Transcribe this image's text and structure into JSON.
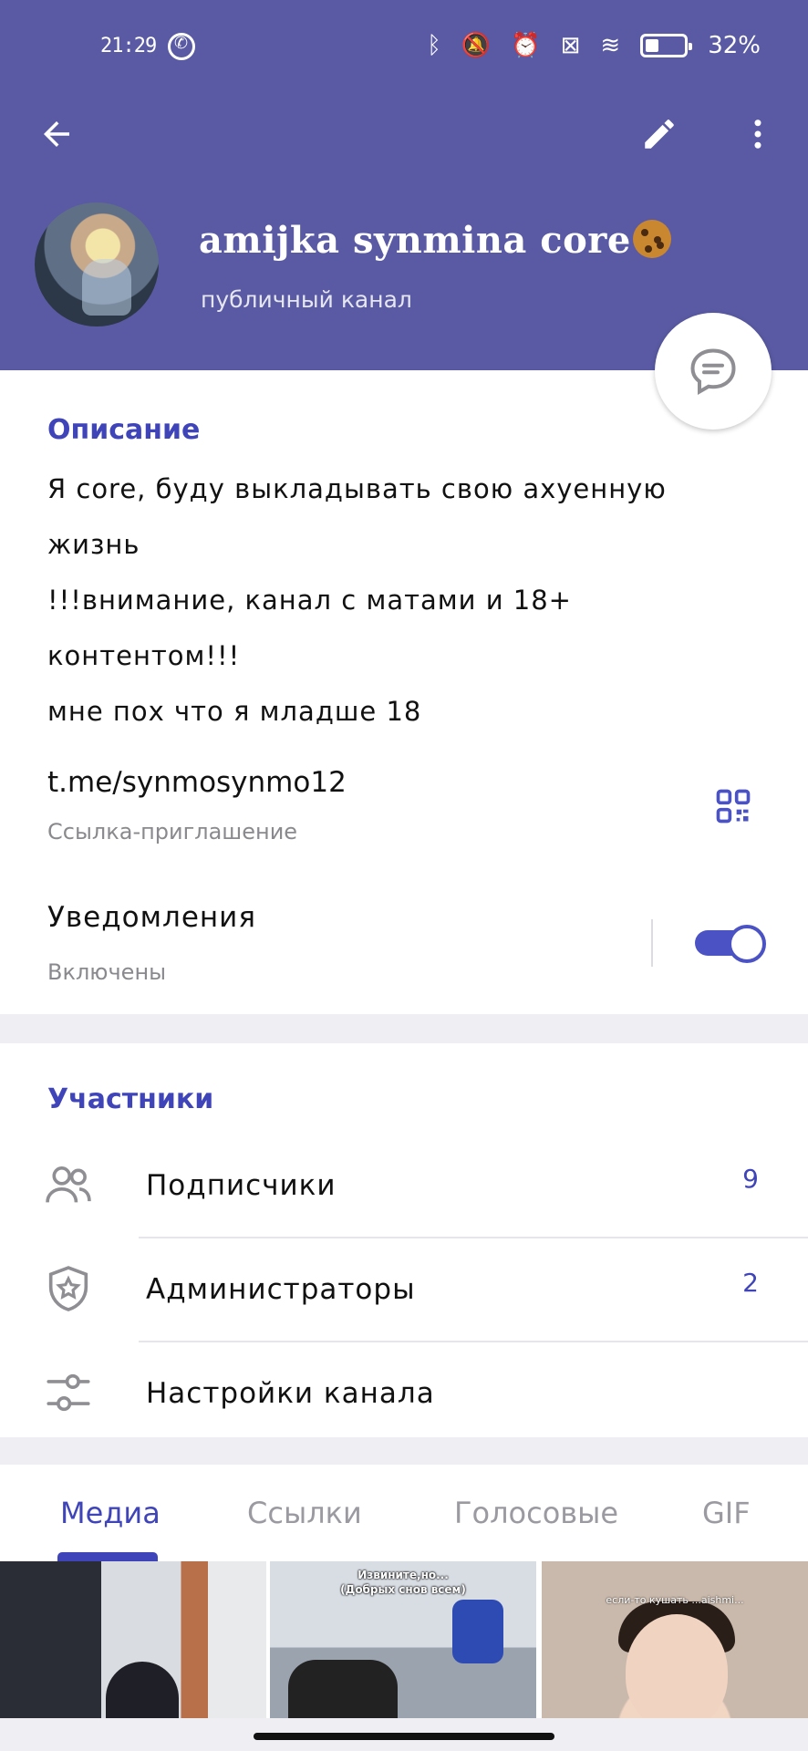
{
  "status_bar": {
    "time": "21:29",
    "battery": "32%",
    "icons": [
      "whatsapp-icon",
      "bluetooth-icon",
      "mute-icon",
      "alarm-icon",
      "no-sim-icon",
      "wifi-icon",
      "battery-icon"
    ]
  },
  "header": {
    "channel_name": "amijka synmina core",
    "channel_type": "публичный канал",
    "accent_color": "#5a5aa4"
  },
  "description": {
    "title": "Описание",
    "lines": [
      "Я core, буду выкладывать свою ахуенную",
      "жизнь",
      "!!!внимание, канал с матами и 18+",
      "контентом!!!",
      "мне пох что я младше 18"
    ]
  },
  "invite": {
    "link": "t.me/synmosynmo12",
    "caption": "Ссылка-приглашение"
  },
  "notifications": {
    "label": "Уведомления",
    "state": "Включены",
    "enabled": true
  },
  "members": {
    "title": "Участники",
    "rows": [
      {
        "label": "Подписчики",
        "count": "9",
        "icon": "people-icon"
      },
      {
        "label": "Администраторы",
        "count": "2",
        "icon": "shield-star-icon"
      },
      {
        "label": "Настройки канала",
        "count": "",
        "icon": "sliders-icon"
      }
    ]
  },
  "tabs": {
    "items": [
      "Медиа",
      "Ссылки",
      "Голосовые",
      "GIF"
    ],
    "active": "Медиа"
  },
  "media": {
    "thumb2_caption_1": "Извините,но...",
    "thumb2_caption_2": "(Добрых снов всем)",
    "thumb3_caption": "если-то кушать ...aishmi..."
  }
}
